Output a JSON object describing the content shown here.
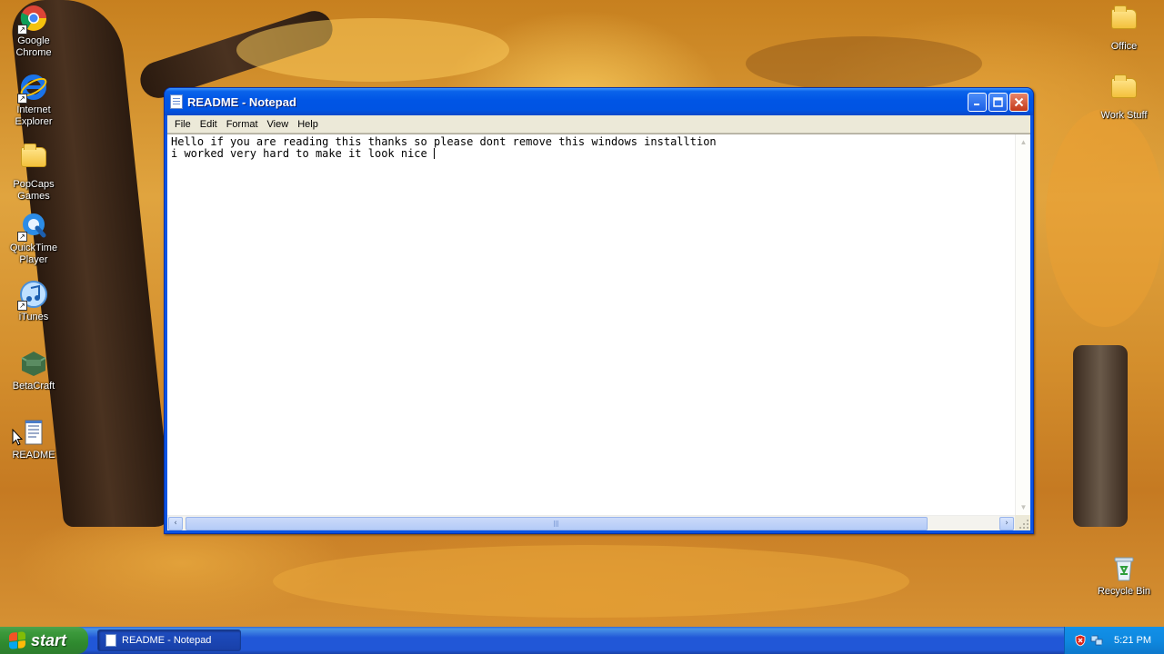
{
  "desktop": {
    "left_icons": [
      {
        "label": "Google Chrome",
        "icon": "chrome-icon"
      },
      {
        "label": "Internet Explorer",
        "icon": "ie-icon"
      },
      {
        "label": "PopCaps Games",
        "icon": "folder-icon"
      },
      {
        "label": "QuickTime Player",
        "icon": "quicktime-icon"
      },
      {
        "label": "iTunes",
        "icon": "itunes-icon"
      },
      {
        "label": "BetaCraft",
        "icon": "betacraft-icon"
      },
      {
        "label": "README",
        "icon": "text-file-icon"
      }
    ],
    "right_icons": [
      {
        "label": "Office",
        "icon": "folder-icon"
      },
      {
        "label": "Work Stuff",
        "icon": "folder-icon"
      },
      {
        "label": "Recycle Bin",
        "icon": "recycle-bin-icon"
      }
    ]
  },
  "window": {
    "title": "README - Notepad",
    "menu": [
      "File",
      "Edit",
      "Format",
      "View",
      "Help"
    ],
    "content_line1": "Hello if you are reading this thanks so please dont remove this windows installtion",
    "content_line2": "i worked very hard to make it look nice "
  },
  "taskbar": {
    "start_label": "start",
    "task_label": "README - Notepad",
    "clock": "5:21 PM"
  },
  "colors": {
    "titlebar": "#0054e3",
    "start": "#3c9a3c",
    "taskbar": "#2157d7"
  }
}
